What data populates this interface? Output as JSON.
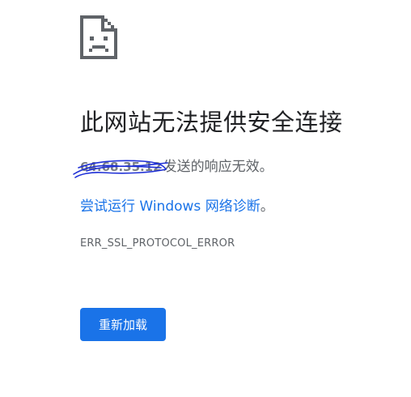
{
  "error": {
    "icon": "sad-page-icon",
    "title": "此网站无法提供安全连接",
    "host": "64.68.35.12",
    "description_suffix": "发送的响应无效。",
    "diagnostics_link": "尝试运行 Windows 网络诊断",
    "diagnostics_suffix": "。",
    "code": "ERR_SSL_PROTOCOL_ERROR"
  },
  "actions": {
    "reload_label": "重新加载"
  },
  "colors": {
    "accent": "#1a73e8",
    "title_text": "#202124",
    "body_text": "#5f6368",
    "scribble": "#1e2fd6"
  }
}
